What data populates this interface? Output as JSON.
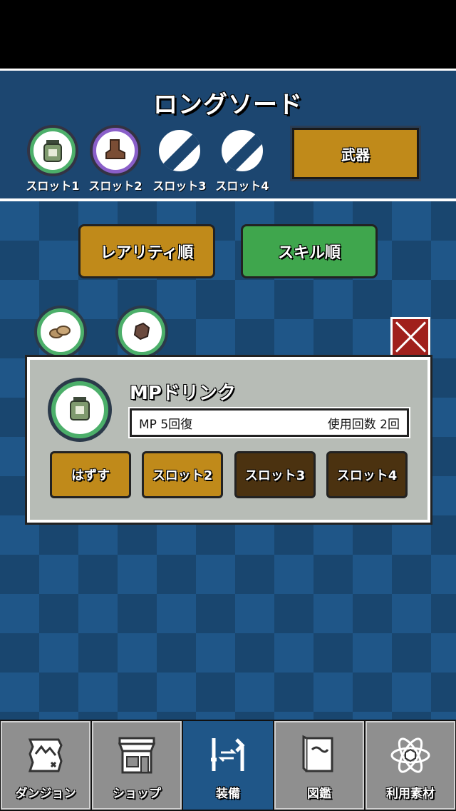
{
  "header": {
    "title": "ロングソード",
    "slots": [
      {
        "label": "スロット1",
        "icon": "mp-drink-bottle-icon",
        "state": "equipped"
      },
      {
        "label": "スロット2",
        "icon": "boot-icon",
        "state": "equipped"
      },
      {
        "label": "スロット3",
        "icon": "empty-slot-icon",
        "state": "empty"
      },
      {
        "label": "スロット4",
        "icon": "empty-slot-icon",
        "state": "empty"
      }
    ],
    "category_button": "武器"
  },
  "sort": {
    "rarity_label": "レアリティ順",
    "skill_label": "スキル順"
  },
  "inventory": [
    {
      "icon": "bread-icon"
    },
    {
      "icon": "ore-icon"
    }
  ],
  "detail": {
    "name": "MPドリンク",
    "icon": "mp-drink-bottle-icon",
    "effect": "MP 5回復",
    "uses": "使用回数 2回",
    "actions": [
      {
        "label": "はずす",
        "style": "gold"
      },
      {
        "label": "スロット2",
        "style": "gold"
      },
      {
        "label": "スロット3",
        "style": "brown"
      },
      {
        "label": "スロット4",
        "style": "brown"
      }
    ]
  },
  "nav": [
    {
      "label": "ダンジョン",
      "icon": "map-icon",
      "active": false
    },
    {
      "label": "ショップ",
      "icon": "shop-icon",
      "active": false
    },
    {
      "label": "装備",
      "icon": "equipment-icon",
      "active": true
    },
    {
      "label": "図鑑",
      "icon": "book-icon",
      "active": false
    },
    {
      "label": "利用素材",
      "icon": "atom-icon",
      "active": false
    }
  ],
  "colors": {
    "gold_button": "#c08a1a",
    "green_button": "#3fa64d",
    "brown_button": "#4b3210",
    "close_button": "#a0201c",
    "background": "#1f5688"
  }
}
